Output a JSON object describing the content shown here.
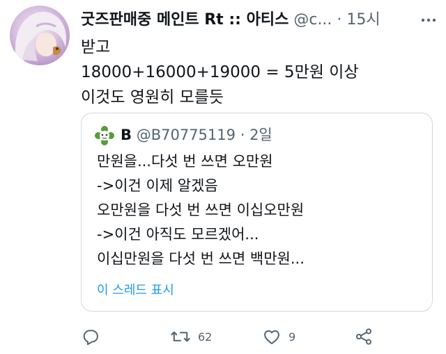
{
  "tweet": {
    "author_name": "굿즈판매중 메인트 Rt :: 아티스",
    "author_handle": "@c...",
    "time": "15시",
    "dot": "·",
    "lines": [
      "받고",
      "18000+16000+19000 = 5만원 이상",
      "이것도 영원히 모를듯"
    ],
    "more_icon": "more-dots-icon"
  },
  "quote": {
    "author_name": "B",
    "author_handle": "@B70775119",
    "dot": "·",
    "time": "2일",
    "lines": [
      "만원을...다섯 번 쓰면 오만원",
      "->이건 이제 알겠음",
      "오만원을 다섯 번 쓰면 이십오만원",
      "->이건 아직도 모르겠어...",
      "이십만원을 다섯 번 쓰면 백만원..."
    ],
    "show_thread": "이 스레드 표시"
  },
  "actions": {
    "reply_icon": "reply-icon",
    "retweet_icon": "retweet-icon",
    "retweet_count": "62",
    "like_icon": "like-icon",
    "like_count": "9",
    "share_icon": "share-icon"
  },
  "colors": {
    "text": "#0f1419",
    "secondary": "#536471",
    "link": "#1d9bf0",
    "border": "#cfd9de"
  }
}
